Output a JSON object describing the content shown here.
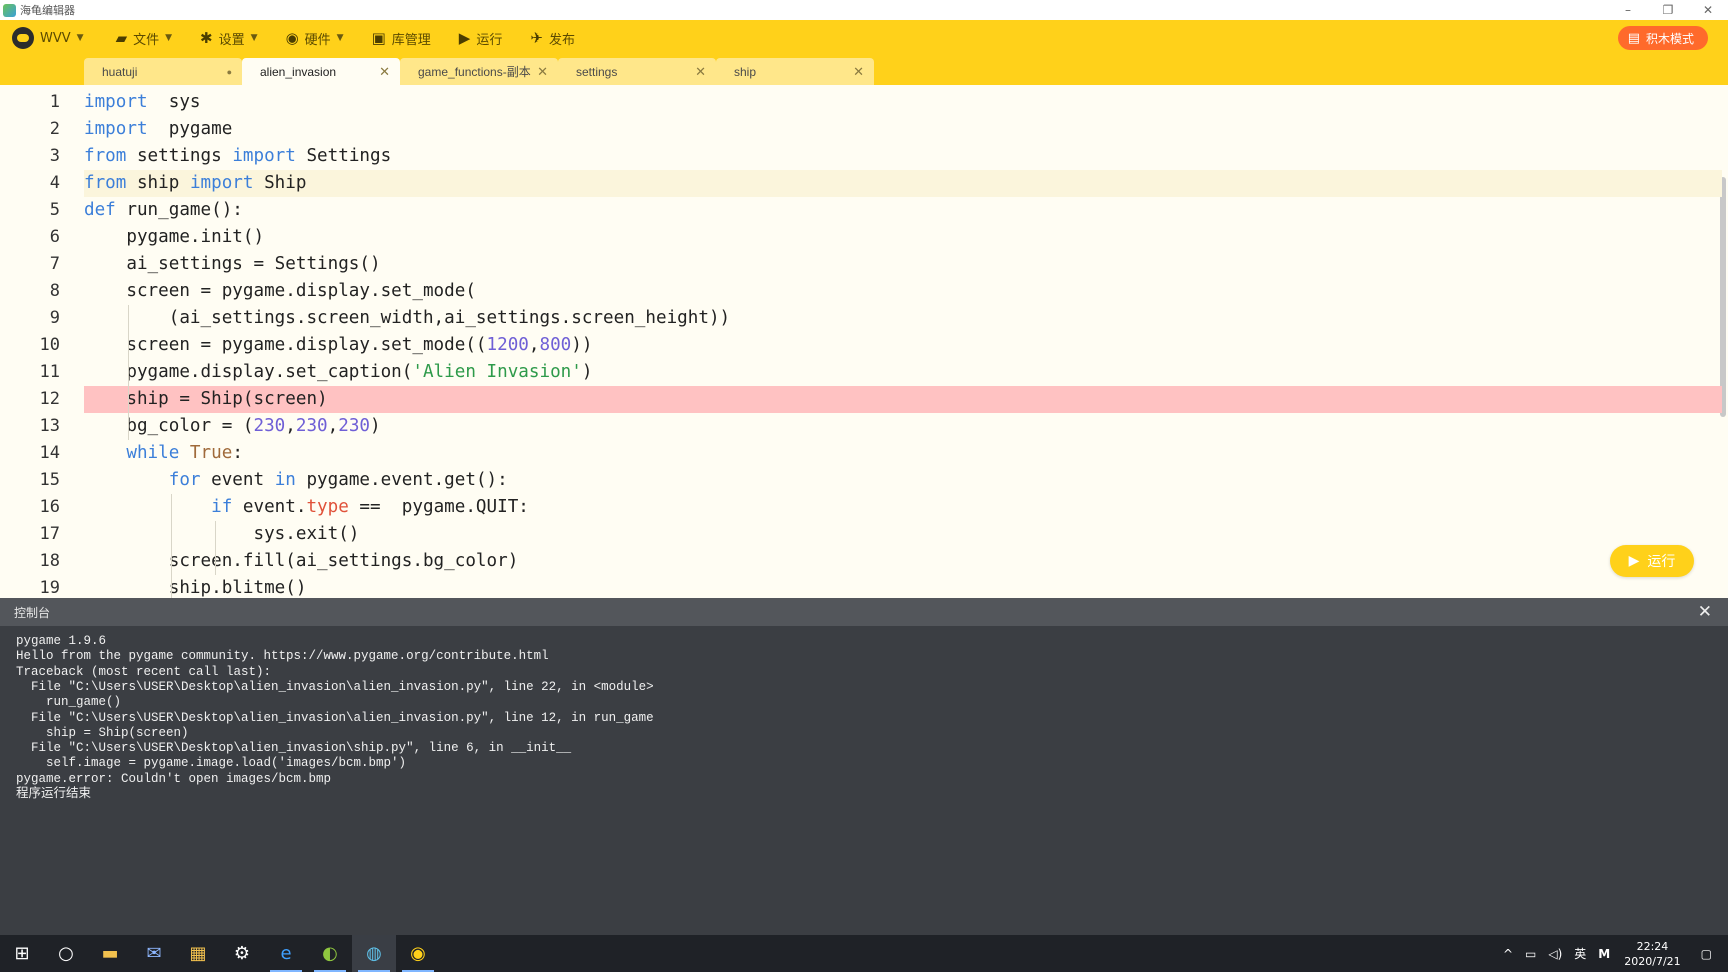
{
  "window": {
    "title": "海龟编辑器",
    "controls": {
      "minimize": "–",
      "restore": "❐",
      "close": "✕"
    }
  },
  "toolbar": {
    "logo_label": "WVV",
    "items": [
      {
        "label": "文件",
        "icon": "folder-icon",
        "glyph": "▰",
        "dropdown": true
      },
      {
        "label": "设置",
        "icon": "gear-icon",
        "glyph": "✱",
        "dropdown": true
      },
      {
        "label": "硬件",
        "icon": "hardware-icon",
        "glyph": "◉",
        "dropdown": true
      },
      {
        "label": "库管理",
        "icon": "library-icon",
        "glyph": "▣",
        "dropdown": false
      },
      {
        "label": "运行",
        "icon": "play-icon",
        "glyph": "▶",
        "dropdown": false
      },
      {
        "label": "发布",
        "icon": "send-icon",
        "glyph": "✈",
        "dropdown": false
      }
    ],
    "block_mode_label": "积木模式"
  },
  "tabs": [
    {
      "label": "huatuji",
      "close": "●",
      "active": false
    },
    {
      "label": "alien_invasion",
      "close": "✕",
      "active": true
    },
    {
      "label": "game_functions-副本",
      "close": "✕",
      "active": false
    },
    {
      "label": "settings",
      "close": "✕",
      "active": false
    },
    {
      "label": "ship",
      "close": "✕",
      "active": false
    }
  ],
  "editor": {
    "lines": [
      {
        "n": "1",
        "tokens": [
          [
            "kw",
            "import"
          ],
          [
            "",
            "  sys"
          ]
        ]
      },
      {
        "n": "2",
        "tokens": [
          [
            "kw",
            "import"
          ],
          [
            "",
            "  pygame"
          ]
        ]
      },
      {
        "n": "3",
        "tokens": [
          [
            "kw",
            "from"
          ],
          [
            "",
            " settings "
          ],
          [
            "kw",
            "import"
          ],
          [
            "",
            " Settings"
          ]
        ]
      },
      {
        "n": "4",
        "tokens": [
          [
            "kw",
            "from"
          ],
          [
            "",
            " ship "
          ],
          [
            "kw",
            "import"
          ],
          [
            "",
            " Ship"
          ]
        ],
        "state": "current"
      },
      {
        "n": "5",
        "tokens": [
          [
            "kw",
            "def"
          ],
          [
            "",
            " run_game():"
          ]
        ]
      },
      {
        "n": "6",
        "tokens": [
          [
            "",
            "    pygame.init()"
          ]
        ]
      },
      {
        "n": "7",
        "tokens": [
          [
            "",
            "    ai_settings = Settings()"
          ]
        ]
      },
      {
        "n": "8",
        "tokens": [
          [
            "",
            "    screen = pygame.display.set_mode("
          ]
        ]
      },
      {
        "n": "9",
        "tokens": [
          [
            "",
            "        (ai_settings.screen_width,ai_settings.screen_height))"
          ]
        ]
      },
      {
        "n": "10",
        "tokens": [
          [
            "",
            "    screen = pygame.display.set_mode(("
          ],
          [
            "num",
            "1200"
          ],
          [
            "",
            ","
          ],
          [
            "num",
            "800"
          ],
          [
            "",
            "))"
          ]
        ]
      },
      {
        "n": "11",
        "tokens": [
          [
            "",
            "    pygame.display.set_caption("
          ],
          [
            "str",
            "'Alien Invasion'"
          ],
          [
            "",
            ")"
          ]
        ]
      },
      {
        "n": "12",
        "tokens": [
          [
            "",
            "    ship = Ship(screen)"
          ]
        ],
        "state": "error"
      },
      {
        "n": "13",
        "tokens": [
          [
            "",
            "    bg_color = ("
          ],
          [
            "num",
            "230"
          ],
          [
            "",
            ","
          ],
          [
            "num",
            "230"
          ],
          [
            "",
            ","
          ],
          [
            "num",
            "230"
          ],
          [
            "",
            ")"
          ]
        ]
      },
      {
        "n": "14",
        "tokens": [
          [
            "kw",
            "    while"
          ],
          [
            "bool",
            " True"
          ],
          [
            "",
            ":"
          ]
        ]
      },
      {
        "n": "15",
        "tokens": [
          [
            "kw",
            "        for"
          ],
          [
            "",
            " event "
          ],
          [
            "kw",
            "in"
          ],
          [
            "",
            " pygame.event.get():"
          ]
        ]
      },
      {
        "n": "16",
        "tokens": [
          [
            "kw",
            "            if"
          ],
          [
            "",
            " event."
          ],
          [
            "attr",
            "type"
          ],
          [
            "",
            " ==  pygame.QUIT:"
          ]
        ]
      },
      {
        "n": "17",
        "tokens": [
          [
            "",
            "                sys.exit()"
          ]
        ]
      },
      {
        "n": "18",
        "tokens": [
          [
            "",
            "        screen.fill(ai_settings.bg_color)"
          ]
        ]
      },
      {
        "n": "19",
        "tokens": [
          [
            "",
            "        ship.blitme()"
          ]
        ]
      }
    ],
    "run_button_label": "运行"
  },
  "console": {
    "title": "控制台",
    "close": "✕",
    "lines": [
      "pygame 1.9.6",
      "Hello from the pygame community. https://www.pygame.org/contribute.html",
      "Traceback (most recent call last):",
      "  File \"C:\\Users\\USER\\Desktop\\alien_invasion\\alien_invasion.py\", line 22, in <module>",
      "    run_game()",
      "  File \"C:\\Users\\USER\\Desktop\\alien_invasion\\alien_invasion.py\", line 12, in run_game",
      "    ship = Ship(screen)",
      "  File \"C:\\Users\\USER\\Desktop\\alien_invasion\\ship.py\", line 6, in __init__",
      "    self.image = pygame.image.load('images/bcm.bmp')",
      "pygame.error: Couldn't open images/bcm.bmp",
      "程序运行结束"
    ]
  },
  "taskbar": {
    "apps": [
      {
        "name": "windows-start-icon",
        "glyph": "⊞"
      },
      {
        "name": "search-circle-icon",
        "glyph": "○"
      },
      {
        "name": "file-explorer-icon",
        "glyph": "▬"
      },
      {
        "name": "mail-icon",
        "glyph": "✉"
      },
      {
        "name": "store-icon",
        "glyph": "▦"
      },
      {
        "name": "settings-gear-icon",
        "glyph": "⚙"
      },
      {
        "name": "edge-browser-icon",
        "glyph": "e"
      },
      {
        "name": "app-green-icon",
        "glyph": "◐"
      },
      {
        "name": "turtle-editor-icon",
        "glyph": "◍"
      },
      {
        "name": "app-yellow-icon",
        "glyph": "◉"
      }
    ],
    "tray": {
      "chevron": "^",
      "network": "▭",
      "volume": "◁)",
      "ime": "英",
      "ime2": "M",
      "time": "22:24",
      "date": "2020/7/21",
      "notification": "▢"
    }
  }
}
